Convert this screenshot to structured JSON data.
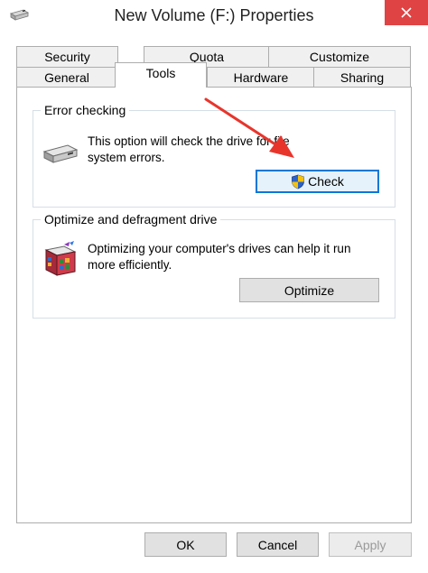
{
  "window": {
    "title": "New Volume (F:) Properties",
    "close_glyph": "×"
  },
  "tabs_row1": [
    {
      "label": "Security"
    },
    {
      "label": "Quota"
    },
    {
      "label": "Customize"
    }
  ],
  "tabs_row2": [
    {
      "label": "General"
    },
    {
      "label": "Tools",
      "active": true
    },
    {
      "label": "Hardware"
    },
    {
      "label": "Sharing"
    }
  ],
  "error_checking": {
    "title": "Error checking",
    "description_line1": "This option will check the drive for file",
    "description_line2": "system errors.",
    "button_label": "Check",
    "icon": "hard-drive-icon",
    "button_icon": "uac-shield-icon"
  },
  "optimize": {
    "title": "Optimize and defragment drive",
    "description_line1": "Optimizing your computer's drives can help it run",
    "description_line2": "more efficiently.",
    "button_label": "Optimize",
    "icon": "defrag-icon"
  },
  "footer": {
    "ok_label": "OK",
    "cancel_label": "Cancel",
    "apply_label": "Apply"
  },
  "colors": {
    "close_button": "#e04343",
    "annotation_arrow": "#e8352c",
    "focus_border": "#0078d7"
  }
}
